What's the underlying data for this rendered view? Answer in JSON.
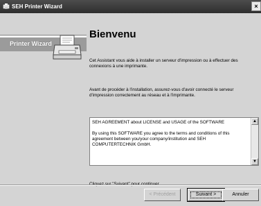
{
  "window": {
    "title": "SEH Printer Wizard",
    "close_label": "×"
  },
  "sidebar": {
    "label": "Printer Wizard",
    "icon": "printer-icon"
  },
  "main": {
    "heading": "Bienvenu",
    "intro": "Cet Assistant vous aide à installer un serveur d'impression ou à effectuer des connexions à une imprimante.",
    "before": "Avant de procéder à l'installation, assurez-vous d'avoir connecté le serveur d'impression correctement au réseau et à l'imprimante.",
    "license_title": "SEH AGREEMENT about LICENSE and USAGE of the SOFTWARE",
    "license_body": "By using this SOFTWARE you agree to the terms and conditions of this agreement between you/your company/institution and SEH COMPUTERTECHNIK GmbH.",
    "continue": "Cliquez sur \"Suivant\" pour continuer."
  },
  "buttons": {
    "back": "< Précédent",
    "next": "Suivant >",
    "cancel": "Annuler"
  }
}
